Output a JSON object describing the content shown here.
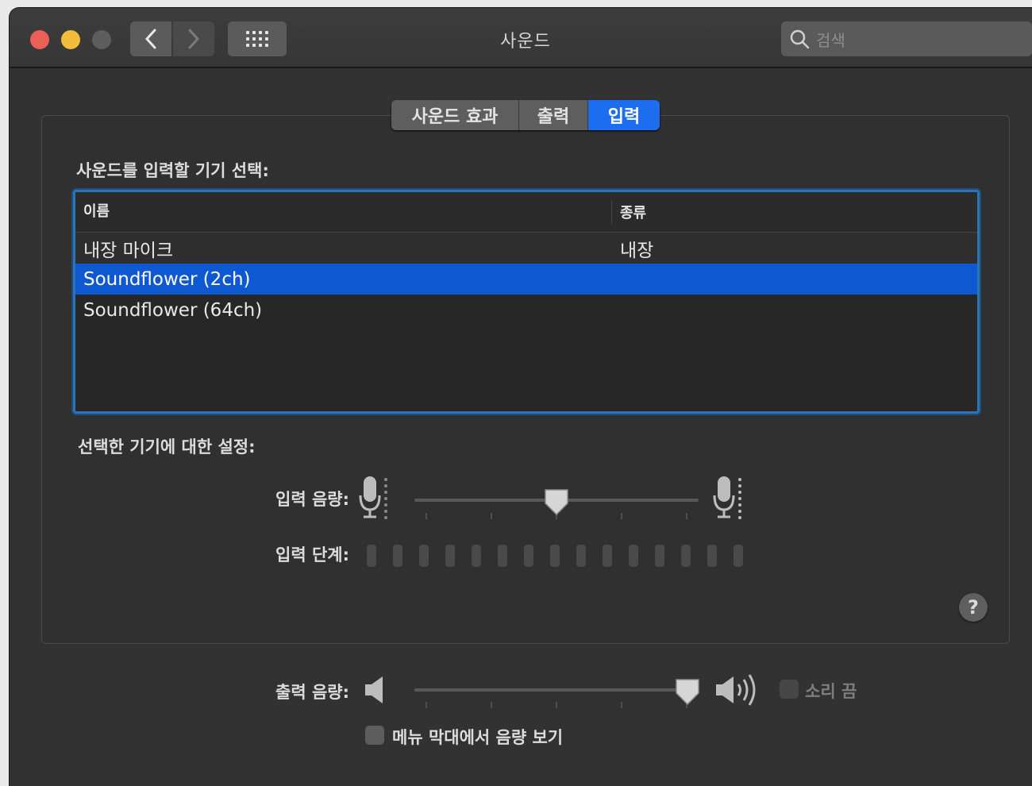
{
  "window": {
    "title": "사운드",
    "search_placeholder": "검색"
  },
  "tabs": [
    {
      "label": "사운드 효과",
      "active": false
    },
    {
      "label": "출력",
      "active": false
    },
    {
      "label": "입력",
      "active": true
    }
  ],
  "input": {
    "device_section_label": "사운드를 입력할 기기 선택:",
    "columns": {
      "name": "이름",
      "type": "종류"
    },
    "devices": [
      {
        "name": "내장 마이크",
        "type": "내장",
        "selected": false
      },
      {
        "name": "Soundflower (2ch)",
        "type": "",
        "selected": true
      },
      {
        "name": "Soundflower (64ch)",
        "type": "",
        "selected": false
      }
    ],
    "settings_label": "선택한 기기에 대한 설정:",
    "volume_label": "입력 음량:",
    "volume_value": 0.5,
    "level_label": "입력 단계:",
    "level_segments": 15
  },
  "output": {
    "volume_label": "출력 음량:",
    "volume_value": 1.0,
    "mute_label": "소리 끔",
    "mute_checked": false,
    "menubar_label": "메뉴 막대에서 음량 보기",
    "menubar_checked": false
  },
  "colors": {
    "accent": "#1d6df1",
    "selection": "#0e58d1",
    "focus_ring": "#2d74b5"
  }
}
